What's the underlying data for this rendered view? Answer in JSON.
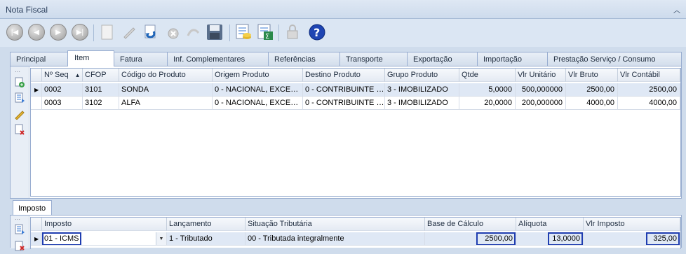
{
  "window": {
    "title": "Nota Fiscal"
  },
  "toolbar": {
    "icons": [
      "first-record-icon",
      "previous-record-icon",
      "next-record-icon",
      "last-record-icon",
      "new-document-icon",
      "edit-icon",
      "undo-icon",
      "delete-icon",
      "cancel-icon",
      "save-icon",
      "calculator-icon",
      "sum-icon",
      "lock-icon",
      "help-icon"
    ]
  },
  "tabs": [
    "Principal",
    "Item",
    "Fatura",
    "Inf. Complementares",
    "Referências",
    "Transporte",
    "Exportação",
    "Importação",
    "Prestação Serviço / Consumo"
  ],
  "active_tab": "Item",
  "items_grid": {
    "columns": [
      "Nº Seq",
      "CFOP",
      "Código do Produto",
      "Origem Produto",
      "Destino Produto",
      "Grupo Produto",
      "Qtde",
      "Vlr Unitário",
      "Vlr Bruto",
      "Vlr Contábil"
    ],
    "sort_indicator": "▲",
    "rows": [
      [
        "0002",
        "3101",
        "SONDA",
        "0 - NACIONAL, EXCET…",
        "0 - CONTRIBUINTE …",
        "3 - IMOBILIZADO",
        "5,0000",
        "500,000000",
        "2500,00",
        "2500,00"
      ],
      [
        "0003",
        "3102",
        "ALFA",
        "0 - NACIONAL, EXCET…",
        "0 - CONTRIBUINTE …",
        "3 - IMOBILIZADO",
        "20,0000",
        "200,000000",
        "4000,00",
        "4000,00"
      ]
    ]
  },
  "subtab": "Imposto",
  "tax_grid": {
    "columns": [
      "Imposto",
      "Lançamento",
      "Situação Tributária",
      "Base de Cálculo",
      "Alíquota",
      "Vlr Imposto"
    ],
    "rows": [
      [
        "01 - ICMS",
        "1 - Tributado",
        "00 - Tributada integralmente",
        "2500,00",
        "13,0000",
        "325,00"
      ]
    ]
  },
  "colors": {
    "accent": "#1f3db0",
    "tab_border": "#98add0",
    "background": "#cfdcec"
  }
}
